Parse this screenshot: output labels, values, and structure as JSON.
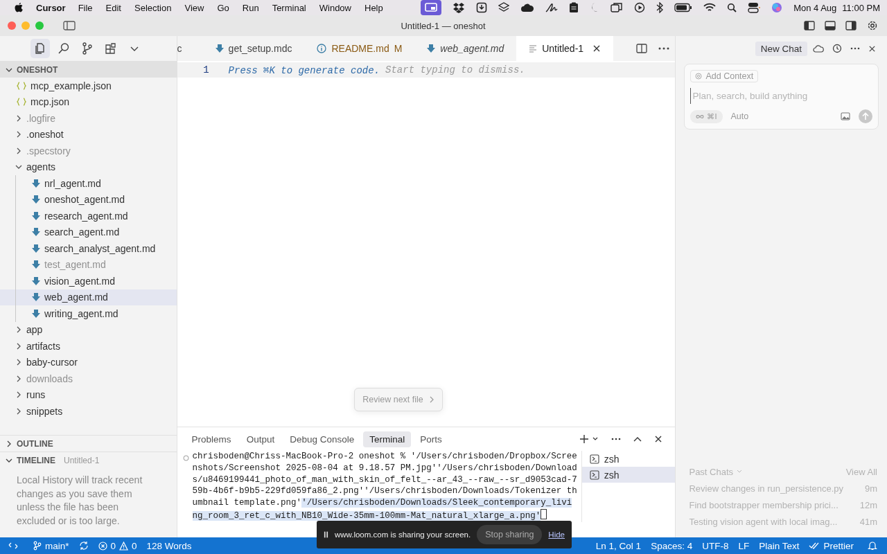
{
  "menubar": {
    "app": "Cursor",
    "menus": [
      "File",
      "Edit",
      "Selection",
      "View",
      "Go",
      "Run",
      "Terminal",
      "Window",
      "Help"
    ],
    "date": "Mon 4 Aug",
    "time": "11:00 PM"
  },
  "window": {
    "title": "Untitled-1 — oneshot"
  },
  "activity_bar": [
    {
      "kind": "files",
      "selected": true
    },
    {
      "kind": "search",
      "selected": false
    },
    {
      "kind": "branch",
      "selected": false
    },
    {
      "kind": "extensions",
      "selected": false
    },
    {
      "kind": "more",
      "selected": false
    }
  ],
  "explorer": {
    "title": "ONESHOT",
    "expanded": true,
    "tree": [
      {
        "kind": "json_file",
        "label": "mcp_example.json",
        "dimmed": false,
        "selected": false
      },
      {
        "kind": "json_file",
        "label": "mcp.json",
        "dimmed": false,
        "selected": false
      },
      {
        "kind": "folder",
        "label": ".logfire",
        "expanded": false,
        "dimmed": true,
        "selected": false
      },
      {
        "kind": "folder",
        "label": ".oneshot",
        "expanded": false,
        "dimmed": false,
        "selected": false
      },
      {
        "kind": "folder",
        "label": ".specstory",
        "expanded": false,
        "dimmed": true,
        "selected": false
      },
      {
        "kind": "folder",
        "label": "agents",
        "expanded": true,
        "dimmed": false,
        "selected": false,
        "children": [
          {
            "kind": "md_file",
            "label": "nrl_agent.md",
            "dimmed": false,
            "selected": false
          },
          {
            "kind": "md_file",
            "label": "oneshot_agent.md",
            "dimmed": false,
            "selected": false
          },
          {
            "kind": "md_file",
            "label": "research_agent.md",
            "dimmed": false,
            "selected": false
          },
          {
            "kind": "md_file",
            "label": "search_agent.md",
            "dimmed": false,
            "selected": false
          },
          {
            "kind": "md_file",
            "label": "search_analyst_agent.md",
            "dimmed": false,
            "selected": false
          },
          {
            "kind": "md_file",
            "label": "test_agent.md",
            "dimmed": true,
            "selected": false
          },
          {
            "kind": "md_file",
            "label": "vision_agent.md",
            "dimmed": false,
            "selected": false
          },
          {
            "kind": "md_file",
            "label": "web_agent.md",
            "dimmed": false,
            "selected": true
          },
          {
            "kind": "md_file",
            "label": "writing_agent.md",
            "dimmed": false,
            "selected": false
          }
        ]
      },
      {
        "kind": "folder",
        "label": "app",
        "expanded": false,
        "dimmed": false,
        "selected": false
      },
      {
        "kind": "folder",
        "label": "artifacts",
        "expanded": false,
        "dimmed": false,
        "selected": false
      },
      {
        "kind": "folder",
        "label": "baby-cursor",
        "expanded": false,
        "dimmed": false,
        "selected": false
      },
      {
        "kind": "folder",
        "label": "downloads",
        "expanded": false,
        "dimmed": true,
        "selected": false
      },
      {
        "kind": "folder",
        "label": "runs",
        "expanded": false,
        "dimmed": false,
        "selected": false
      },
      {
        "kind": "folder",
        "label": "snippets",
        "expanded": false,
        "dimmed": false,
        "selected": false
      }
    ]
  },
  "outline": {
    "title": "OUTLINE",
    "expanded": false
  },
  "timeline": {
    "title": "TIMELINE",
    "subtitle": "Untitled-1",
    "expanded": true,
    "message": "Local History will track recent changes as you save them unless the file has been excluded or is too large."
  },
  "editor_tabs": [
    {
      "label": "c",
      "kind": "plain",
      "italic": false,
      "selected": false
    },
    {
      "label": "get_setup.mdc",
      "kind": "markdown",
      "italic": false,
      "selected": false
    },
    {
      "label": "README.md",
      "kind": "readme",
      "badge": "M",
      "italic": false,
      "selected": false
    },
    {
      "label": "web_agent.md",
      "kind": "markdown",
      "italic": true,
      "selected": false
    },
    {
      "label": "Untitled-1",
      "kind": "text",
      "italic": false,
      "selected": true
    }
  ],
  "editor": {
    "line_number": "1",
    "hint": "Press ⌘K to generate code.",
    "hint_rest": "Start typing to dismiss.",
    "review_button": "Review next file"
  },
  "panel": {
    "tabs": [
      {
        "label": "Problems",
        "selected": false
      },
      {
        "label": "Output",
        "selected": false
      },
      {
        "label": "Debug Console",
        "selected": false
      },
      {
        "label": "Terminal",
        "selected": true
      },
      {
        "label": "Ports",
        "selected": false
      }
    ],
    "terminal_text": "chrisboden@Chriss-MacBook-Pro-2 oneshot % '/Users/chrisboden/Dropbox/Screenshots/Screenshot 2025-08-04 at 9.18.57 PM.jpg''/Users/chrisboden/Downloads/u8469199441_photo_of_man_with_skin_of_felt_--ar_43_--raw_--sr_d9053cad-759b-4b6f-b9b5-229fd059fa86_2.png''/Users/chrisboden/Downloads/Tokenizer thumbnail template.png'",
    "terminal_selected_text": "'/Users/chrisboden/Downloads/Sleek_contemporary_living_room_3_ret_c_with_NB10_Wide-35mm-100mm-Mat_natural_xlarge_a.png'",
    "shells": [
      {
        "label": "zsh",
        "selected": false
      },
      {
        "label": "zsh",
        "selected": true
      }
    ]
  },
  "chat": {
    "new_chat": "New Chat",
    "add_context": "Add Context",
    "placeholder": "Plan, search, build anything",
    "mode": "⌘I",
    "model": "Auto",
    "past_chats_title": "Past Chats",
    "view_all": "View All",
    "past_chats": [
      {
        "title": "Review changes in run_persistence.py",
        "age": "9m"
      },
      {
        "title": "Find bootstrapper membership prici...",
        "age": "12m"
      },
      {
        "title": "Testing vision agent with local imag...",
        "age": "41m"
      }
    ]
  },
  "status_bar": {
    "branch": "main*",
    "errors": "0",
    "warnings": "0",
    "words": "128 Words",
    "items": [
      "Ln 1, Col 1",
      "Spaces: 4",
      "UTF-8",
      "LF",
      "Plain Text"
    ],
    "formatter": "Prettier"
  },
  "loom": {
    "message": "www.loom.com is sharing your screen.",
    "stop": "Stop sharing",
    "hide": "Hide"
  }
}
